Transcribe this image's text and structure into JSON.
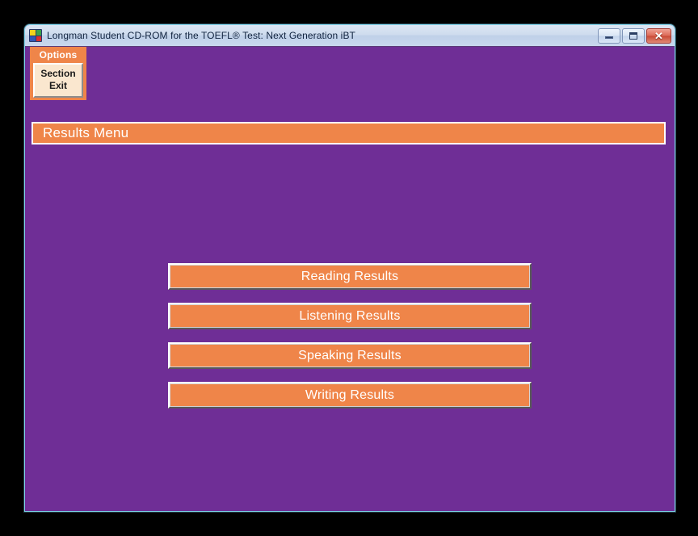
{
  "window": {
    "title": "Longman Student CD-ROM for the TOEFL® Test: Next Generation iBT",
    "icon": "app-grid-icon",
    "controls": {
      "minimize_label": "–",
      "maximize_label": "□",
      "close_label": "✕"
    },
    "colors": {
      "purple": "#6f2e96",
      "orange": "#ef8549",
      "beige": "#fae7cf",
      "title_bar": "#cfdcee",
      "frame_border": "#7fd4ea"
    }
  },
  "options_panel": {
    "title": "Options",
    "section_exit_line1": "Section",
    "section_exit_line2": "Exit"
  },
  "results_menu": {
    "header": "Results Menu",
    "buttons": [
      {
        "label": "Reading Results"
      },
      {
        "label": "Listening Results"
      },
      {
        "label": "Speaking Results"
      },
      {
        "label": "Writing Results"
      }
    ]
  }
}
